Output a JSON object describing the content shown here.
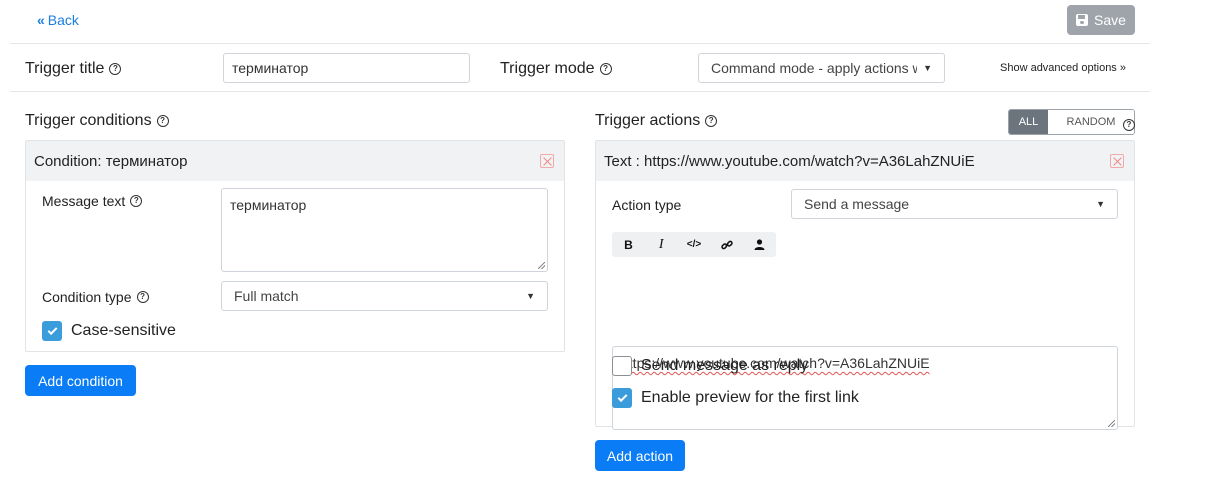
{
  "header": {
    "back_label": "Back",
    "save_label": "Save"
  },
  "trigger": {
    "title_label": "Trigger title",
    "title_value": "терминатор",
    "mode_label": "Trigger mode",
    "mode_value": "Command mode - apply actions w",
    "advanced_label": "Show advanced options »"
  },
  "conditions": {
    "section_label": "Trigger conditions",
    "items": [
      {
        "header": "Condition: терминатор",
        "message_label": "Message text",
        "message_value": "терминатор",
        "type_label": "Condition type",
        "type_value": "Full match",
        "case_sensitive_label": "Case-sensitive",
        "case_sensitive": true
      }
    ],
    "add_label": "Add condition"
  },
  "actions": {
    "section_label": "Trigger actions",
    "mode_all": "ALL",
    "mode_random": "RANDOM",
    "items": [
      {
        "header": "Text : https://www.youtube.com/watch?v=A36LahZNUiE",
        "type_label": "Action type",
        "type_value": "Send a message",
        "toolbar": [
          "bold-icon",
          "italic-icon",
          "code-icon",
          "link-icon",
          "user-icon"
        ],
        "text_value": "https://www.youtube.com/watch?v=A36LahZNUiE",
        "reply_label": "Send message as reply",
        "reply_checked": false,
        "preview_label": "Enable preview for the first link",
        "preview_checked": true
      }
    ],
    "add_label": "Add action"
  },
  "colors": {
    "primary": "#0a7cf5",
    "link": "#1a7fe0",
    "checkbox_checked": "#3b9cdc",
    "save_disabled": "#9aa0a6"
  }
}
